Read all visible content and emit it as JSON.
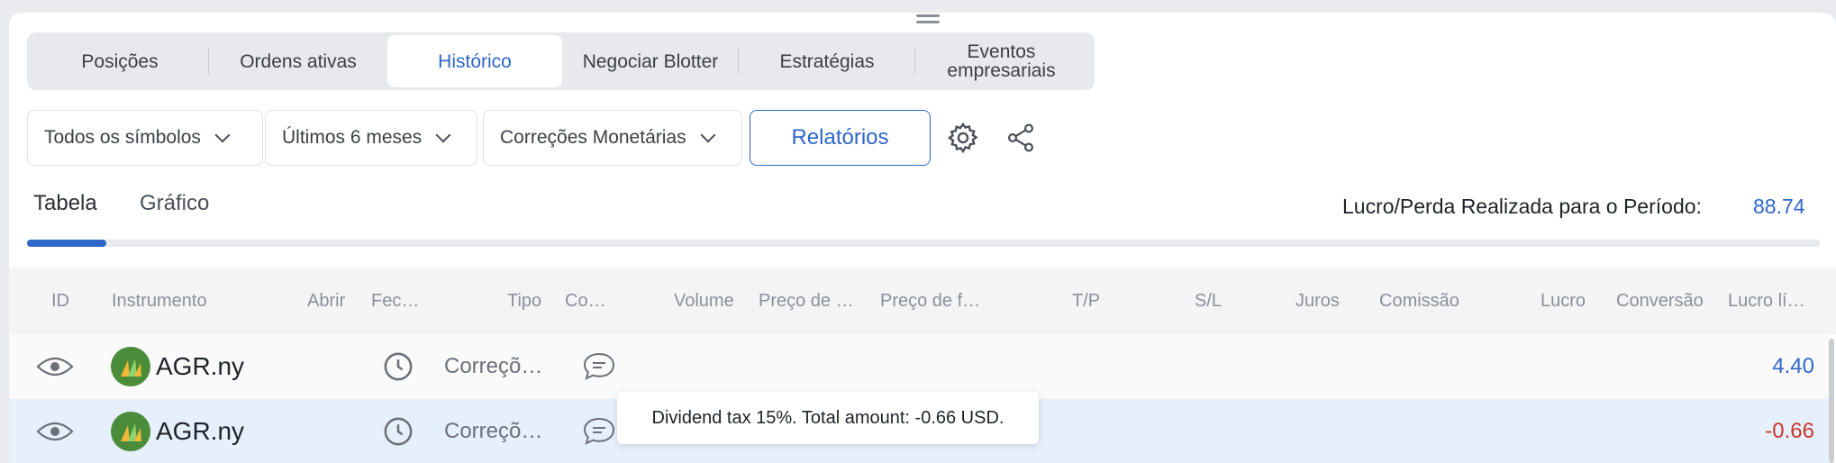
{
  "main_tabs": [
    {
      "label": "Posições"
    },
    {
      "label": "Ordens ativas"
    },
    {
      "label": "Histórico"
    },
    {
      "label": "Negociar Blotter"
    },
    {
      "label": "Estratégias"
    },
    {
      "label": "Eventos\nempresariais"
    }
  ],
  "filters": {
    "symbols": "Todos os símbolos",
    "period": "Últimos 6 meses",
    "type": "Correções Monetárias",
    "reports_button": "Relatórios"
  },
  "view_tabs": {
    "table": "Tabela",
    "chart": "Gráfico"
  },
  "period_pnl": {
    "label": "Lucro/Perda Realizada para o Período:",
    "value": "88.74"
  },
  "table": {
    "columns": {
      "id": "ID",
      "instrument": "Instrumento",
      "open": "Abrir",
      "close": "Fec…",
      "type": "Tipo",
      "comment": "Co…",
      "volume": "Volume",
      "open_price": "Preço de …",
      "close_price": "Preço de f…",
      "tp": "T/P",
      "sl": "S/L",
      "interest": "Juros",
      "commission": "Comissão",
      "profit": "Lucro",
      "conversion": "Conversão",
      "net_profit": "Lucro lí…"
    },
    "rows": [
      {
        "symbol": "AGR.ny",
        "type": "Correçõ…",
        "net_profit": "4.40",
        "profit_color": "#2e66c9"
      },
      {
        "symbol": "AGR.ny",
        "type": "Correçõ…",
        "net_profit": "-0.66",
        "profit_color": "#c8372d"
      }
    ]
  },
  "tooltip": {
    "text": "Dividend tax 15%. Total amount: -0.66 USD."
  },
  "colors": {
    "accent": "#2e66c9",
    "negative": "#c8372d",
    "selected_row": "#e6effc"
  },
  "icons": [
    "gear-icon",
    "share-icon",
    "eye-icon",
    "clock-icon",
    "comment-icon",
    "chevron-down-icon"
  ]
}
